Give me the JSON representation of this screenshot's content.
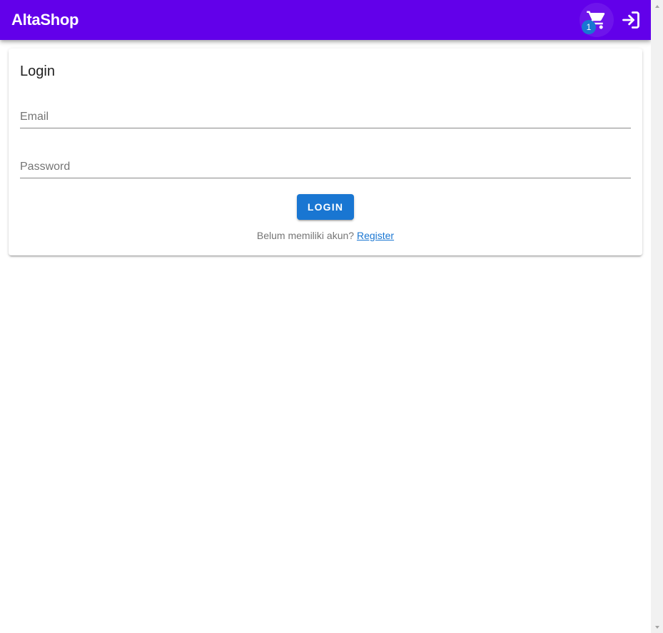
{
  "app": {
    "brand": "AltaShop",
    "cart_count": "1",
    "cart_icon": "cart-icon",
    "login_icon": "login-icon"
  },
  "login_card": {
    "title": "Login",
    "email_placeholder": "Email",
    "password_placeholder": "Password",
    "button_label": "LOGIN",
    "register_prompt": "Belum memiliki akun?",
    "register_link": "Register"
  },
  "colors": {
    "appbar": "#6200ea",
    "primary": "#1976d2"
  }
}
